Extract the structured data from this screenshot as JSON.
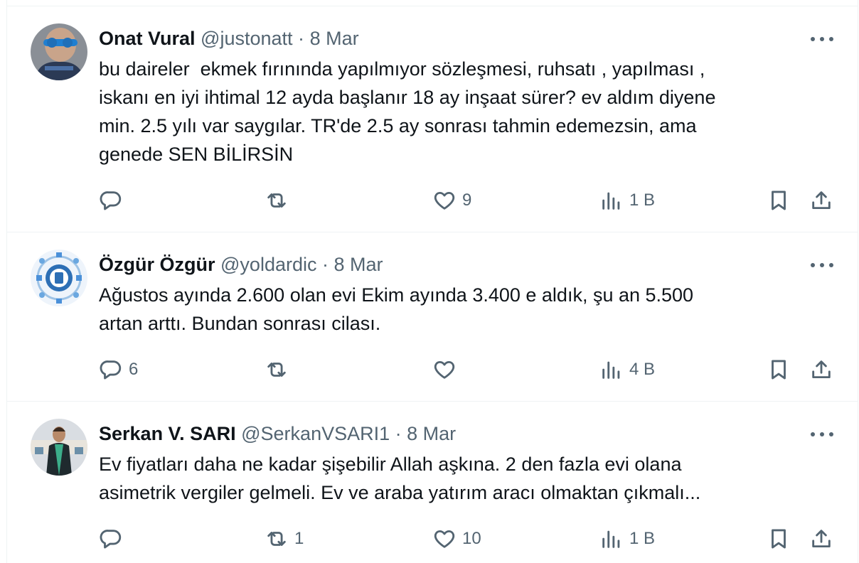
{
  "tweets": [
    {
      "name": "Onat Vural",
      "handle": "@justonatt",
      "dot": "·",
      "date": "8 Mar",
      "text": "bu daireler  ekmek fırınında yapılmıyor sözleşmesi, ruhsatı , yapılması ,\niskanı en iyi ihtimal 12 ayda başlanır 18 ay inşaat sürer? ev aldım diyene\nmin. 2.5 yılı var saygılar. TR'de 2.5 ay sonrası tahmin edemezsin, ama\ngenede SEN BİLİRSİN",
      "replies": "",
      "reposts": "",
      "likes": "9",
      "views": "1 B"
    },
    {
      "name": "Özgür Özgür",
      "handle": "@yoldardic",
      "dot": "·",
      "date": "8 Mar",
      "text": "Ağustos ayında 2.600 olan evi Ekim ayında 3.400 e aldık, şu an 5.500\nartan arttı. Bundan sonrası cilası.",
      "replies": "6",
      "reposts": "",
      "likes": "",
      "views": "4 B"
    },
    {
      "name": "Serkan V. SARI",
      "handle": "@SerkanVSARI1",
      "dot": "·",
      "date": "8 Mar",
      "text": "Ev fiyatları daha ne kadar şişebilir Allah aşkına. 2 den fazla evi olana\nasimetrik vergiler gelmeli. Ev ve araba yatırım aracı olmaktan çıkmalı...",
      "replies": "",
      "reposts": "1",
      "likes": "10",
      "views": "1 B"
    }
  ],
  "icons": {
    "reply": "reply-icon",
    "repost": "repost-icon",
    "like": "heart-icon",
    "views": "views-icon",
    "bookmark": "bookmark-icon",
    "share": "share-icon",
    "more": "more-icon"
  },
  "colors": {
    "text": "#0f1419",
    "secondary": "#536471",
    "border": "#eff3f4"
  }
}
